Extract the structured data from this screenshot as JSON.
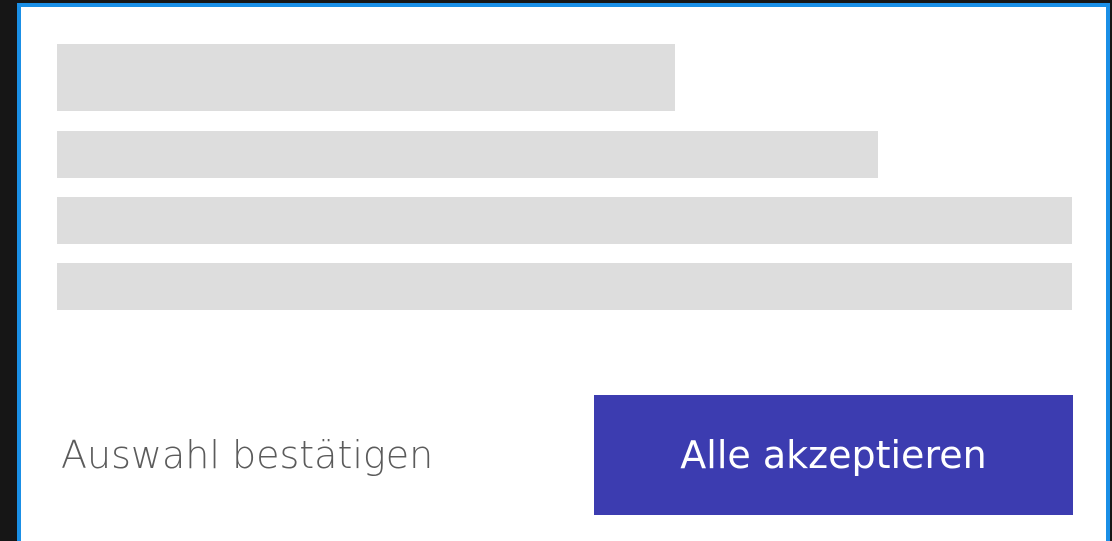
{
  "consent_dialog": {
    "confirm_selection_label": "Auswahl bestätigen",
    "accept_all_label": "Alle akzeptieren",
    "colors": {
      "frame_border": "#1a8fe6",
      "primary_button": "#3c3cb0",
      "skeleton": "#dddddd",
      "background": "#161616"
    }
  }
}
